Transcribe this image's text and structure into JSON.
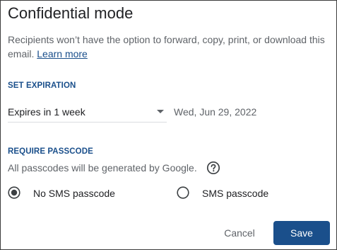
{
  "dialog": {
    "title": "Confidential mode",
    "description_text": "Recipients won’t have the option to forward, copy, print, or download this email.",
    "learn_more_label": "Learn more"
  },
  "expiration": {
    "heading": "SET EXPIRATION",
    "selected_option": "Expires in 1 week",
    "expiry_date": "Wed, Jun 29, 2022"
  },
  "passcode": {
    "heading": "REQUIRE PASSCODE",
    "note": "All passcodes will be generated by Google.",
    "help_icon": "help-circle-icon",
    "options": [
      {
        "label": "No SMS passcode",
        "selected": true
      },
      {
        "label": "SMS passcode",
        "selected": false
      }
    ]
  },
  "actions": {
    "cancel_label": "Cancel",
    "save_label": "Save"
  },
  "colors": {
    "accent": "#1a4f8b",
    "secondary_text": "#5f6368",
    "primary_text": "#202124"
  }
}
